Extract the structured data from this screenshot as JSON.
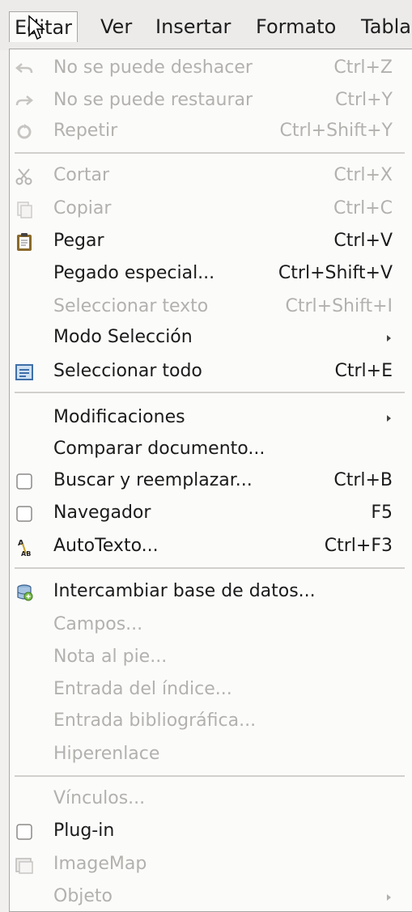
{
  "menubar": {
    "items": [
      {
        "label": "Editar"
      },
      {
        "label": "Ver"
      },
      {
        "label": "Insertar"
      },
      {
        "label": "Formato"
      },
      {
        "label": "Tabla"
      }
    ]
  },
  "menu": {
    "items": [
      {
        "label": "No se puede deshacer",
        "shortcut": "Ctrl+Z",
        "icon": "undo-icon",
        "enabled": false
      },
      {
        "label": "No se puede restaurar",
        "shortcut": "Ctrl+Y",
        "icon": "redo-icon",
        "enabled": false
      },
      {
        "label": "Repetir",
        "shortcut": "Ctrl+Shift+Y",
        "icon": "repeat-icon",
        "enabled": false
      },
      {
        "label": "Cortar",
        "shortcut": "Ctrl+X",
        "icon": "scissors-icon",
        "enabled": false
      },
      {
        "label": "Copiar",
        "shortcut": "Ctrl+C",
        "icon": "copy-icon",
        "enabled": false
      },
      {
        "label": "Pegar",
        "shortcut": "Ctrl+V",
        "icon": "clipboard-icon",
        "enabled": true
      },
      {
        "label": "Pegado especial...",
        "shortcut": "Ctrl+Shift+V",
        "enabled": true
      },
      {
        "label": "Seleccionar texto",
        "shortcut": "Ctrl+Shift+I",
        "enabled": false
      },
      {
        "label": "Modo Selección",
        "enabled": true,
        "submenu": true
      },
      {
        "label": "Seleccionar todo",
        "shortcut": "Ctrl+E",
        "icon": "select-all-icon",
        "enabled": true
      },
      {
        "label": "Modificaciones",
        "enabled": true,
        "submenu": true
      },
      {
        "label": "Comparar documento...",
        "enabled": true
      },
      {
        "label": "Buscar y reemplazar...",
        "shortcut": "Ctrl+B",
        "icon": "checkbox-icon",
        "enabled": true
      },
      {
        "label": "Navegador",
        "shortcut": "F5",
        "icon": "checkbox-icon",
        "enabled": true
      },
      {
        "label": "AutoTexto...",
        "shortcut": "Ctrl+F3",
        "icon": "autotext-icon",
        "enabled": true
      },
      {
        "label": "Intercambiar base de datos...",
        "icon": "database-icon",
        "enabled": true
      },
      {
        "label": "Campos...",
        "enabled": false
      },
      {
        "label": "Nota al pie...",
        "enabled": false
      },
      {
        "label": "Entrada del índice...",
        "enabled": false
      },
      {
        "label": "Entrada bibliográfica...",
        "enabled": false
      },
      {
        "label": "Hiperenlace",
        "enabled": false
      },
      {
        "label": "Vínculos...",
        "enabled": false
      },
      {
        "label": "Plug-in",
        "icon": "checkbox-icon",
        "enabled": true
      },
      {
        "label": "ImageMap",
        "icon": "imagemap-icon",
        "enabled": false
      },
      {
        "label": "Objeto",
        "enabled": false,
        "submenu": true
      }
    ]
  }
}
